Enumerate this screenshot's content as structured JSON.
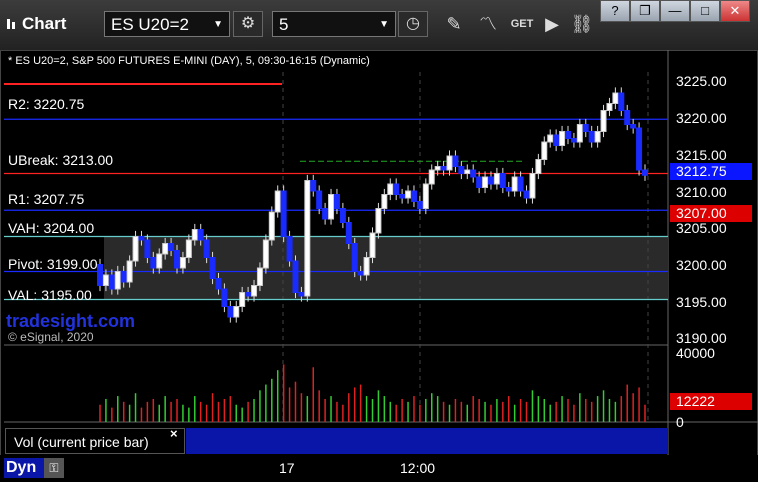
{
  "window": {
    "title": "Chart",
    "symbol": "ES U20=2",
    "interval": "5",
    "buttons": {
      "help": "?",
      "restore": "❐",
      "minimize": "—",
      "maximize": "□",
      "close": "✕"
    }
  },
  "chart_header": "* ES U20=2, S&P 500 FUTURES E-MINI (DAY), 5, 09:30-16:15 (Dynamic)",
  "levels": [
    {
      "label": "R2: 3220.75",
      "price": 3220.75,
      "color": "#1a2bff"
    },
    {
      "label": "UBreak: 3213.00",
      "price": 3213.0,
      "color": "#ff2222"
    },
    {
      "label": "R1: 3207.75",
      "price": 3207.75,
      "color": "#1a2bff"
    },
    {
      "label": "VAH: 3204.00",
      "price": 3204.0,
      "color": "#66cccc"
    },
    {
      "label": "Pivot: 3199.00",
      "price": 3199.0,
      "color": "#1a2bff"
    },
    {
      "label": "VAL: 3195.00",
      "price": 3195.0,
      "color": "#66cccc"
    }
  ],
  "watermark": "tradesight.com",
  "copyright": "© eSignal, 2020",
  "y_axis": {
    "ticks": [
      "3225.00",
      "3220.00",
      "3215.00",
      "3210.00",
      "3205.00",
      "3200.00",
      "3195.00",
      "3190.00"
    ],
    "last_price": "3212.75",
    "last_price_color": "#0a16ff",
    "level_badge": "3207.00",
    "level_badge_color": "#dd0000"
  },
  "volume_axis": {
    "ticks": [
      "40000",
      "0"
    ],
    "last_volume": "12222",
    "badge_color": "#dd0000"
  },
  "volume_study_label": "Vol (current price bar)",
  "volume_close": "×",
  "bottom": {
    "mode": "Dyn",
    "x_labels": [
      "17",
      "12:00"
    ]
  },
  "chart_data": {
    "type": "candlestick",
    "ylim": [
      3188.5,
      3227.5
    ],
    "series": [
      {
        "name": "ES U20=2",
        "open": [
          3200.0,
          3197.0,
          3198.5,
          3196.5,
          3199.0,
          3197.5,
          3200.5,
          3204.0,
          3203.5,
          3201.0,
          3199.5,
          3201.5,
          3203.0,
          3202.0,
          3199.5,
          3201.0,
          3203.5,
          3205.0,
          3203.5,
          3201.0,
          3198.0,
          3196.5,
          3194.0,
          3192.5,
          3194.0,
          3196.0,
          3195.5,
          3197.0,
          3199.5,
          3203.5,
          3207.5,
          3210.5,
          3204.0,
          3200.5,
          3196.0,
          3195.5,
          3212.0,
          3210.5,
          3208.0,
          3206.5,
          3210.0,
          3208.0,
          3206.0,
          3203.0,
          3199.0,
          3198.5,
          3201.0,
          3204.5,
          3208.0,
          3210.0,
          3211.5,
          3210.0,
          3209.5,
          3210.5,
          3209.0,
          3208.0,
          3211.5,
          3213.5,
          3214.0,
          3213.5,
          3215.5,
          3214.0,
          3213.0,
          3213.5,
          3212.5,
          3211.0,
          3212.5,
          3211.5,
          3213.0,
          3211.0,
          3210.5,
          3212.5,
          3210.5,
          3209.5,
          3213.0,
          3215.0,
          3217.5,
          3218.5,
          3217.0,
          3219.0,
          3218.0,
          3217.5,
          3220.0,
          3219.0,
          3217.5,
          3219.0,
          3222.0,
          3223.0,
          3224.5,
          3222.0,
          3220.0,
          3219.5,
          3213.5
        ],
        "close": [
          3197.0,
          3198.5,
          3196.5,
          3199.0,
          3197.5,
          3200.5,
          3204.0,
          3203.5,
          3201.0,
          3199.5,
          3201.5,
          3203.0,
          3202.0,
          3199.5,
          3201.0,
          3203.5,
          3205.0,
          3203.5,
          3201.0,
          3198.0,
          3196.5,
          3194.0,
          3192.5,
          3194.0,
          3196.0,
          3195.5,
          3197.0,
          3199.5,
          3203.5,
          3207.5,
          3210.5,
          3204.0,
          3200.5,
          3196.0,
          3195.5,
          3212.0,
          3210.5,
          3208.0,
          3206.5,
          3210.0,
          3208.0,
          3206.0,
          3203.0,
          3199.0,
          3198.5,
          3201.0,
          3204.5,
          3208.0,
          3210.0,
          3211.5,
          3210.0,
          3209.5,
          3210.5,
          3209.0,
          3208.0,
          3211.5,
          3213.5,
          3214.0,
          3213.5,
          3215.5,
          3214.0,
          3213.0,
          3213.5,
          3212.5,
          3211.0,
          3212.5,
          3211.5,
          3213.0,
          3211.0,
          3210.5,
          3212.5,
          3210.5,
          3209.5,
          3213.0,
          3215.0,
          3217.5,
          3218.5,
          3217.0,
          3219.0,
          3218.0,
          3217.5,
          3220.0,
          3219.0,
          3217.5,
          3219.0,
          3222.0,
          3223.0,
          3224.5,
          3222.0,
          3220.0,
          3219.5,
          3213.5,
          3212.75
        ]
      }
    ],
    "volume": [
      6,
      8,
      5,
      9,
      7,
      6,
      10,
      5,
      7,
      8,
      6,
      9,
      7,
      8,
      6,
      5,
      9,
      7,
      6,
      10,
      7,
      8,
      9,
      6,
      5,
      7,
      8,
      11,
      13,
      15,
      18,
      20,
      12,
      14,
      10,
      9,
      19,
      11,
      8,
      9,
      7,
      6,
      10,
      12,
      13,
      9,
      8,
      11,
      9,
      7,
      6,
      8,
      7,
      9,
      6,
      8,
      10,
      9,
      7,
      6,
      8,
      7,
      6,
      9,
      8,
      7,
      6,
      8,
      7,
      9,
      6,
      8,
      7,
      11,
      9,
      8,
      6,
      7,
      9,
      8,
      6,
      10,
      8,
      7,
      9,
      11,
      8,
      7,
      9,
      13,
      10,
      12,
      6
    ]
  }
}
